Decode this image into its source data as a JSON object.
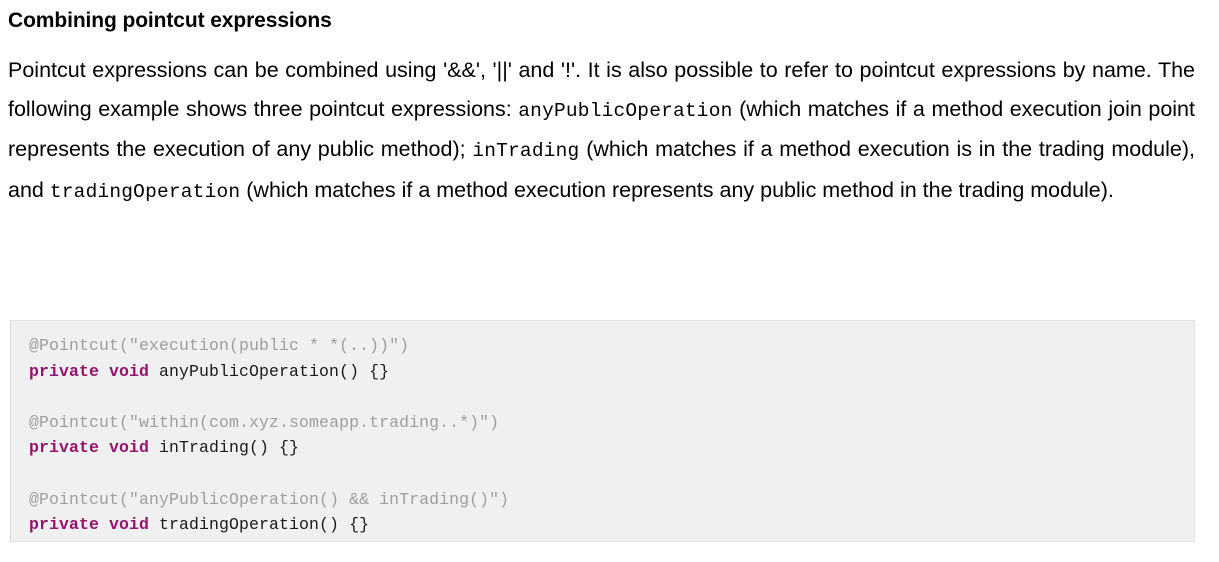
{
  "heading": "Combining pointcut expressions",
  "paragraph": {
    "seg1": "Pointcut expressions can be combined using '&&', '||' and '!'. It is also possible to refer to pointcut expressions by name. The following example shows three pointcut expressions: ",
    "code1": "anyPublicOperation",
    "seg2": " (which matches if a method execution join point represents the execution of any public method); ",
    "code2": "inTrading",
    "seg3": " (which matches if a method execution is in the trading module), and ",
    "code3": "tradingOperation",
    "seg4": " (which matches if a method execution represents any public method in the trading module)."
  },
  "code_block": {
    "background": "#f0f0f0",
    "keyword_color": "#93136d",
    "annotation_color": "#9e9e9e",
    "string_color": "#9e9e9e",
    "stanzas": [
      {
        "annotation": "@Pointcut(",
        "string": "\"execution(public * *(..))\"",
        "annotation_close": ")",
        "keywords": "private void",
        "signature": " anyPublicOperation() {}"
      },
      {
        "annotation": "@Pointcut(",
        "string": "\"within(com.xyz.someapp.trading..*)\"",
        "annotation_close": ")",
        "keywords": "private void",
        "signature": " inTrading() {}"
      },
      {
        "annotation": "@Pointcut(",
        "string": "\"anyPublicOperation() && inTrading()\"",
        "annotation_close": ")",
        "keywords": "private void",
        "signature": " tradingOperation() {}"
      }
    ]
  }
}
